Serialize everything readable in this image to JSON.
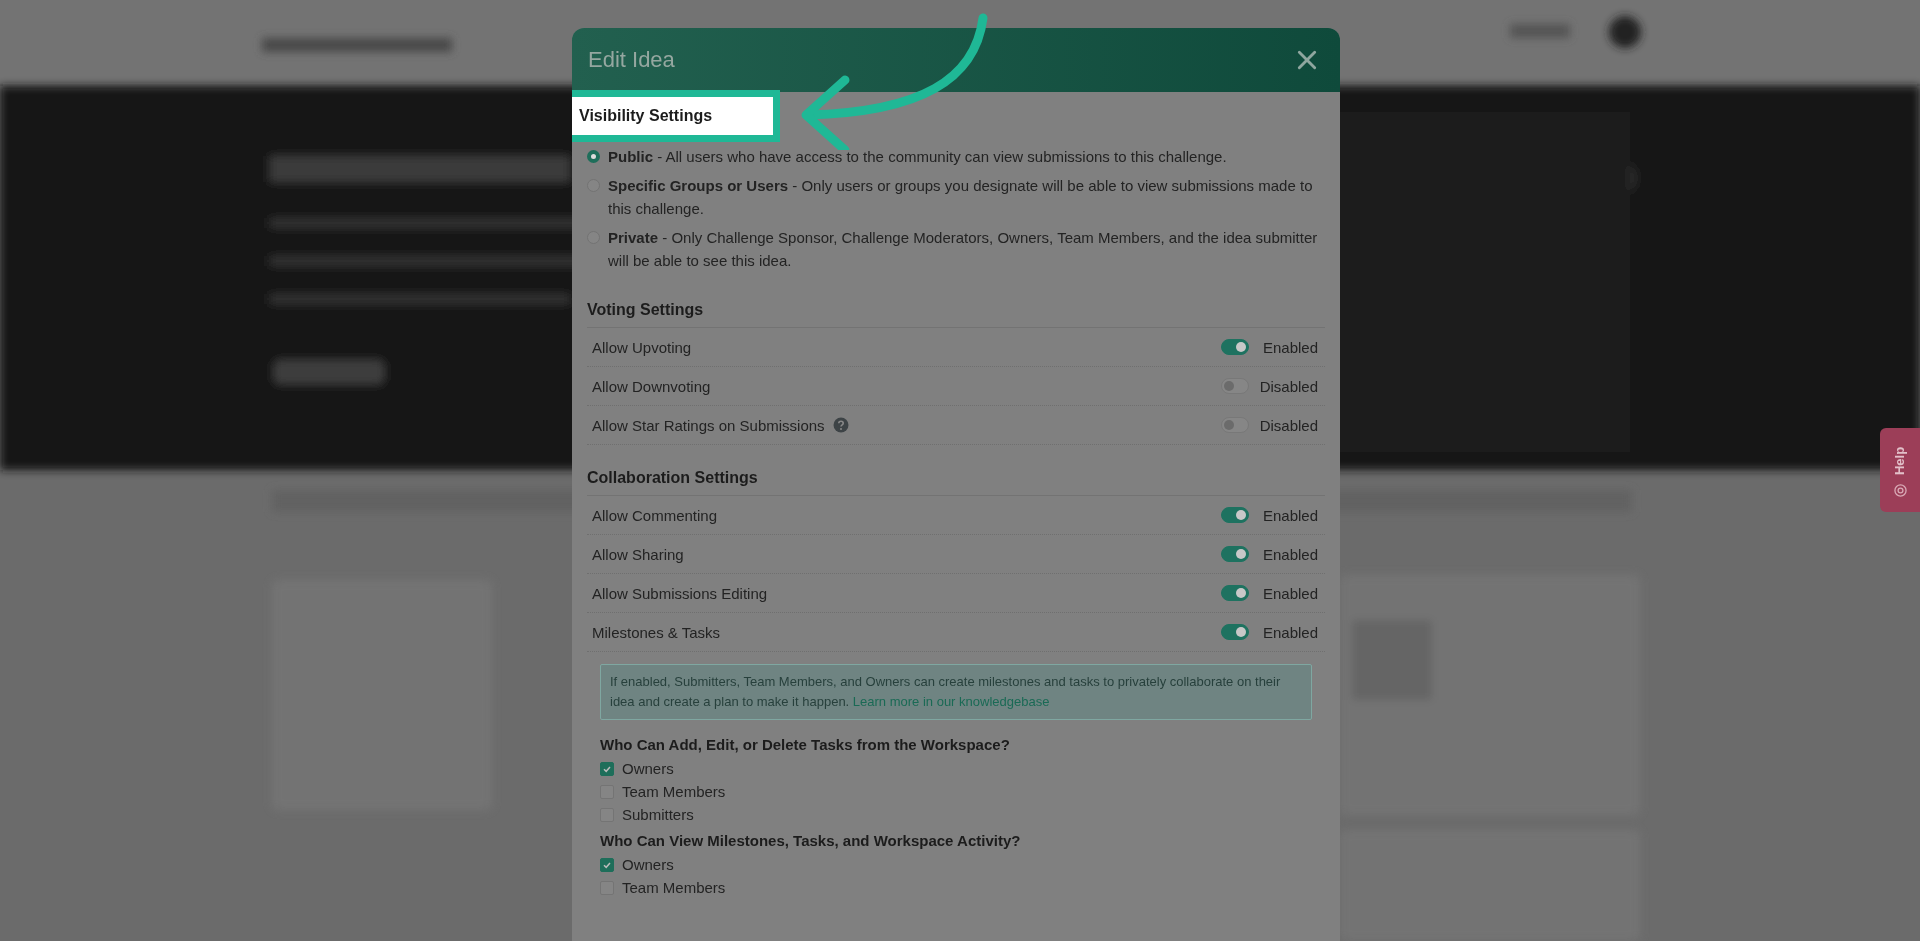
{
  "dialog": {
    "title": "Edit Idea",
    "visibility": {
      "heading": "Visibility Settings",
      "highlighted": true,
      "options": [
        {
          "label": "**Public** - All users who have access to the community can view submissions to this challenge.",
          "selected": true
        },
        {
          "label": "**Specific Groups or Users** - Only users or groups you designate will be able to view submissions made to this challenge.",
          "selected": false
        },
        {
          "label": "**Private** - Only Challenge Sponsor, Challenge Moderators, Owners, Team Members, and the idea submitter will be able to see this idea.",
          "selected": false
        }
      ]
    },
    "voting": {
      "heading": "Voting Settings",
      "settings": [
        {
          "label": "Allow Upvoting",
          "on": true,
          "status": "Enabled",
          "help": false
        },
        {
          "label": "Allow Downvoting",
          "on": false,
          "status": "Disabled",
          "help": false
        },
        {
          "label": "Allow Star Ratings on Submissions",
          "on": false,
          "status": "Disabled",
          "help": true
        }
      ]
    },
    "collaboration": {
      "heading": "Collaboration Settings",
      "settings": [
        {
          "label": "Allow Commenting",
          "on": true,
          "status": "Enabled",
          "help": false
        },
        {
          "label": "Allow Sharing",
          "on": true,
          "status": "Enabled",
          "help": false
        },
        {
          "label": "Allow Submissions Editing",
          "on": true,
          "status": "Enabled",
          "help": false
        },
        {
          "label": "Milestones & Tasks",
          "on": true,
          "status": "Enabled",
          "help": false
        }
      ],
      "info": {
        "text": "If enabled, Submitters, Team Members, and Owners can create milestones and tasks to privately collaborate on their idea and create a plan to make it happen.",
        "link": "Learn more in our knowledgebase"
      },
      "permission_groups": [
        {
          "question": "Who Can Add, Edit, or Delete Tasks from the Workspace?",
          "options": [
            {
              "label": "Owners",
              "checked": true
            },
            {
              "label": "Team Members",
              "checked": false
            },
            {
              "label": "Submitters",
              "checked": false
            }
          ]
        },
        {
          "question": "Who Can View Milestones, Tasks, and Workspace Activity?",
          "options": [
            {
              "label": "Owners",
              "checked": true
            },
            {
              "label": "Team Members",
              "checked": false
            }
          ]
        }
      ]
    }
  },
  "help_tab": {
    "label": "Help"
  }
}
